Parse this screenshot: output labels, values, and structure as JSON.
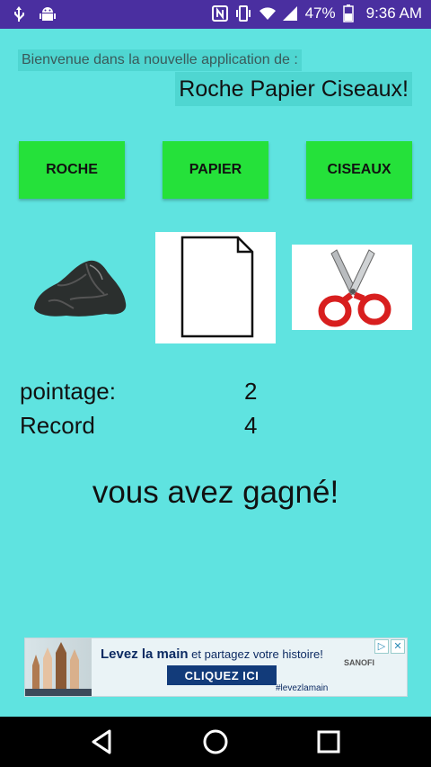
{
  "status_bar": {
    "battery_percent": "47%",
    "time": "9:36 AM",
    "left_icons": [
      "usb-icon",
      "android-icon"
    ],
    "right_icons": [
      "nfc-icon",
      "vibrate-icon",
      "wifi-icon",
      "signal-icon",
      "battery-icon"
    ]
  },
  "header": {
    "welcome": "Bienvenue dans la nouvelle application de :",
    "title": "Roche Papier Ciseaux!"
  },
  "buttons": {
    "rock": "ROCHE",
    "paper": "PAPIER",
    "scissors": "CISEAUX"
  },
  "images": [
    "rock-image",
    "paper-image",
    "scissors-image"
  ],
  "scores": {
    "score_label": "pointage:",
    "score_value": "2",
    "record_label": "Record",
    "record_value": "4"
  },
  "result": "vous avez gagné!",
  "ad": {
    "headline_a": "Levez la main",
    "headline_b": " et partagez votre histoire!",
    "cta": "CLIQUEZ ICI",
    "hashtag": "#levezlamain",
    "sponsor": "SANOFI"
  },
  "colors": {
    "background": "#5fe3e0",
    "status_bar": "#4a2fa0",
    "button": "#25e13a",
    "label_highlight": "#4fd6d1"
  }
}
